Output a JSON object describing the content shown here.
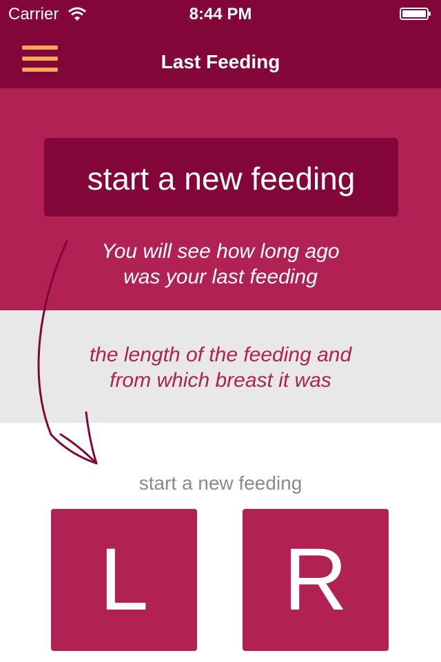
{
  "status_bar": {
    "carrier": "Carrier",
    "time": "8:44 PM"
  },
  "nav": {
    "title": "Last Feeding"
  },
  "hero": {
    "start_button_label": "start a new feeding",
    "hint_line1": "You will see how long ago",
    "hint_line2": "was your last feeding"
  },
  "info": {
    "line1": "the length of the feeding and",
    "line2": "from which breast it was"
  },
  "bottom": {
    "subtitle": "start a new feeding",
    "left_label": "L",
    "right_label": "R"
  },
  "colors": {
    "bar": "#820637",
    "accent": "#b02154",
    "menu_icon": "#f7a85a",
    "band": "#e8e8e8"
  }
}
